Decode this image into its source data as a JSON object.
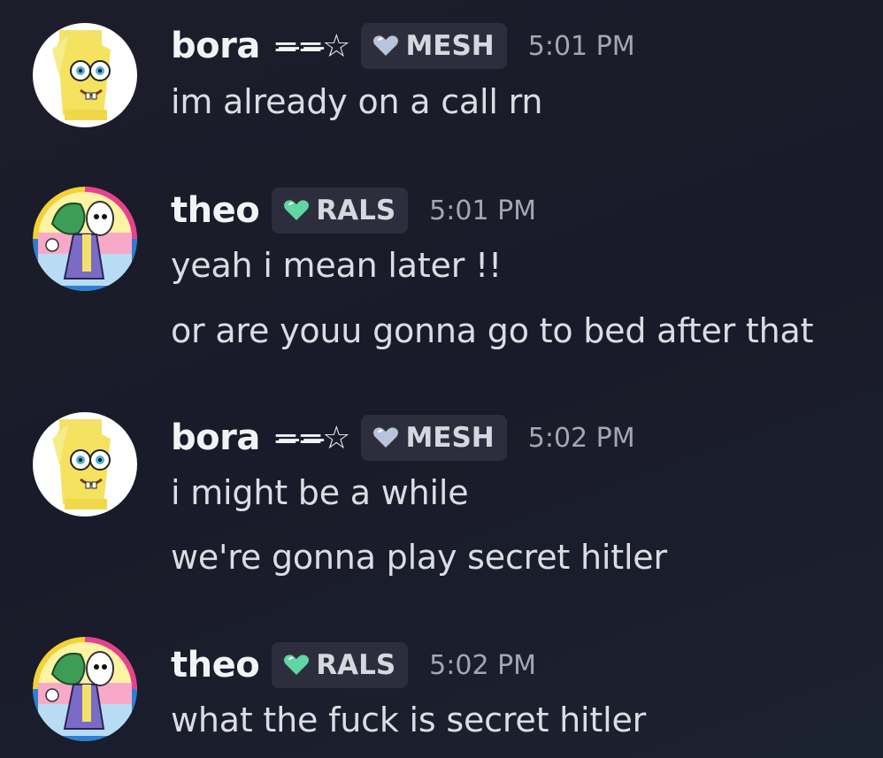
{
  "messages": [
    {
      "username": "bora",
      "decoration": "=̶=̶☆",
      "tag": "MESH",
      "tag_color": "#b8c4de",
      "timestamp": "5:01 PM",
      "avatar": "spongebob-avatar",
      "lines": [
        "im already on a call rn"
      ]
    },
    {
      "username": "theo",
      "decoration": "",
      "tag": "RALS",
      "tag_color": "#5fd6a4",
      "timestamp": "5:01 PM",
      "avatar": "green-character-avatar",
      "lines": [
        "yeah i mean later !!",
        "or are youu gonna go to bed after that"
      ]
    },
    {
      "username": "bora",
      "decoration": "=̶=̶☆",
      "tag": "MESH",
      "tag_color": "#b8c4de",
      "timestamp": "5:02 PM",
      "avatar": "spongebob-avatar",
      "lines": [
        "i might be a while",
        "we're gonna play secret hitler"
      ]
    },
    {
      "username": "theo",
      "decoration": "",
      "tag": "RALS",
      "tag_color": "#5fd6a4",
      "timestamp": "5:02 PM",
      "avatar": "green-character-avatar",
      "lines": [
        "what the fuck is secret hitler"
      ]
    }
  ]
}
